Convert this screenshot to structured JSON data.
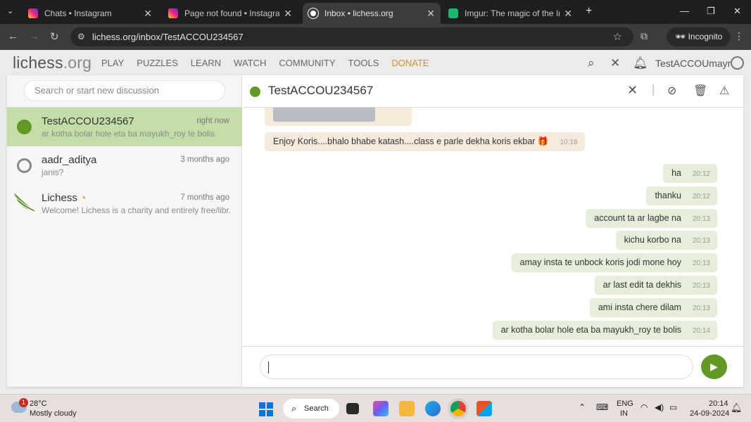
{
  "browser": {
    "tabs": [
      {
        "title": "Chats • Instagram",
        "icon": "instagram-icon"
      },
      {
        "title": "Page not found • Instagram",
        "icon": "instagram-icon"
      },
      {
        "title": "Inbox • lichess.org",
        "icon": "lichess-icon",
        "active": true
      },
      {
        "title": "Imgur: The magic of the Interne",
        "icon": "imgur-icon"
      }
    ],
    "url": "lichess.org/inbox/TestACCOU234567",
    "incognito_label": "Incognito"
  },
  "site": {
    "logo_main": "lichess",
    "logo_suffix": ".org",
    "nav": [
      "PLAY",
      "PUZZLES",
      "LEARN",
      "WATCH",
      "COMMUNITY",
      "TOOLS"
    ],
    "donate": "DONATE",
    "username": "TestACCOUmayr"
  },
  "inbox": {
    "search_placeholder": "Search or start new discussion",
    "contacts": [
      {
        "name": "TestACCOU234567",
        "time": "right now",
        "preview": "ar kotha bolar hole eta ba mayukh_roy te bolis",
        "status": "online",
        "selected": true
      },
      {
        "name": "aadr_aditya",
        "time": "3 months ago",
        "preview": "janis?",
        "status": "offline"
      },
      {
        "name": "Lichess",
        "time": "7 months ago",
        "preview": "Welcome! Lichess is a charity and entirely free/libr...",
        "status": "lichess"
      }
    ]
  },
  "conversation": {
    "title": "TestACCOU234567",
    "messages": [
      {
        "text": "Enjoy Koris....bhalo bhabe katash....class e parle dekha koris ekbar 🎁",
        "time": "10:18",
        "dir": "in"
      },
      {
        "text": "ha",
        "time": "20:12",
        "dir": "out"
      },
      {
        "text": "thanku",
        "time": "20:12",
        "dir": "out"
      },
      {
        "text": "account ta ar lagbe na",
        "time": "20:13",
        "dir": "out"
      },
      {
        "text": "kichu korbo na",
        "time": "20:13",
        "dir": "out"
      },
      {
        "text": "amay insta te unbock koris jodi mone hoy",
        "time": "20:13",
        "dir": "out"
      },
      {
        "text": "ar last edit ta dekhis",
        "time": "20:13",
        "dir": "out"
      },
      {
        "text": "ami insta chere dilam",
        "time": "20:13",
        "dir": "out"
      },
      {
        "text": "ar kotha bolar hole eta ba mayukh_roy te bolis",
        "time": "20:14",
        "dir": "out"
      }
    ]
  },
  "taskbar": {
    "weather_badge": "1",
    "temperature": "28°C",
    "condition": "Mostly cloudy",
    "search_label": "Search",
    "lang_top": "ENG",
    "lang_bottom": "IN",
    "time": "20:14",
    "date": "24-09-2024"
  },
  "colors": {
    "accent_green": "#629924",
    "selected_row": "#c3dda7",
    "donate": "#d59120",
    "incoming_bubble": "#f6eadb",
    "outgoing_bubble": "#e6eed9"
  }
}
